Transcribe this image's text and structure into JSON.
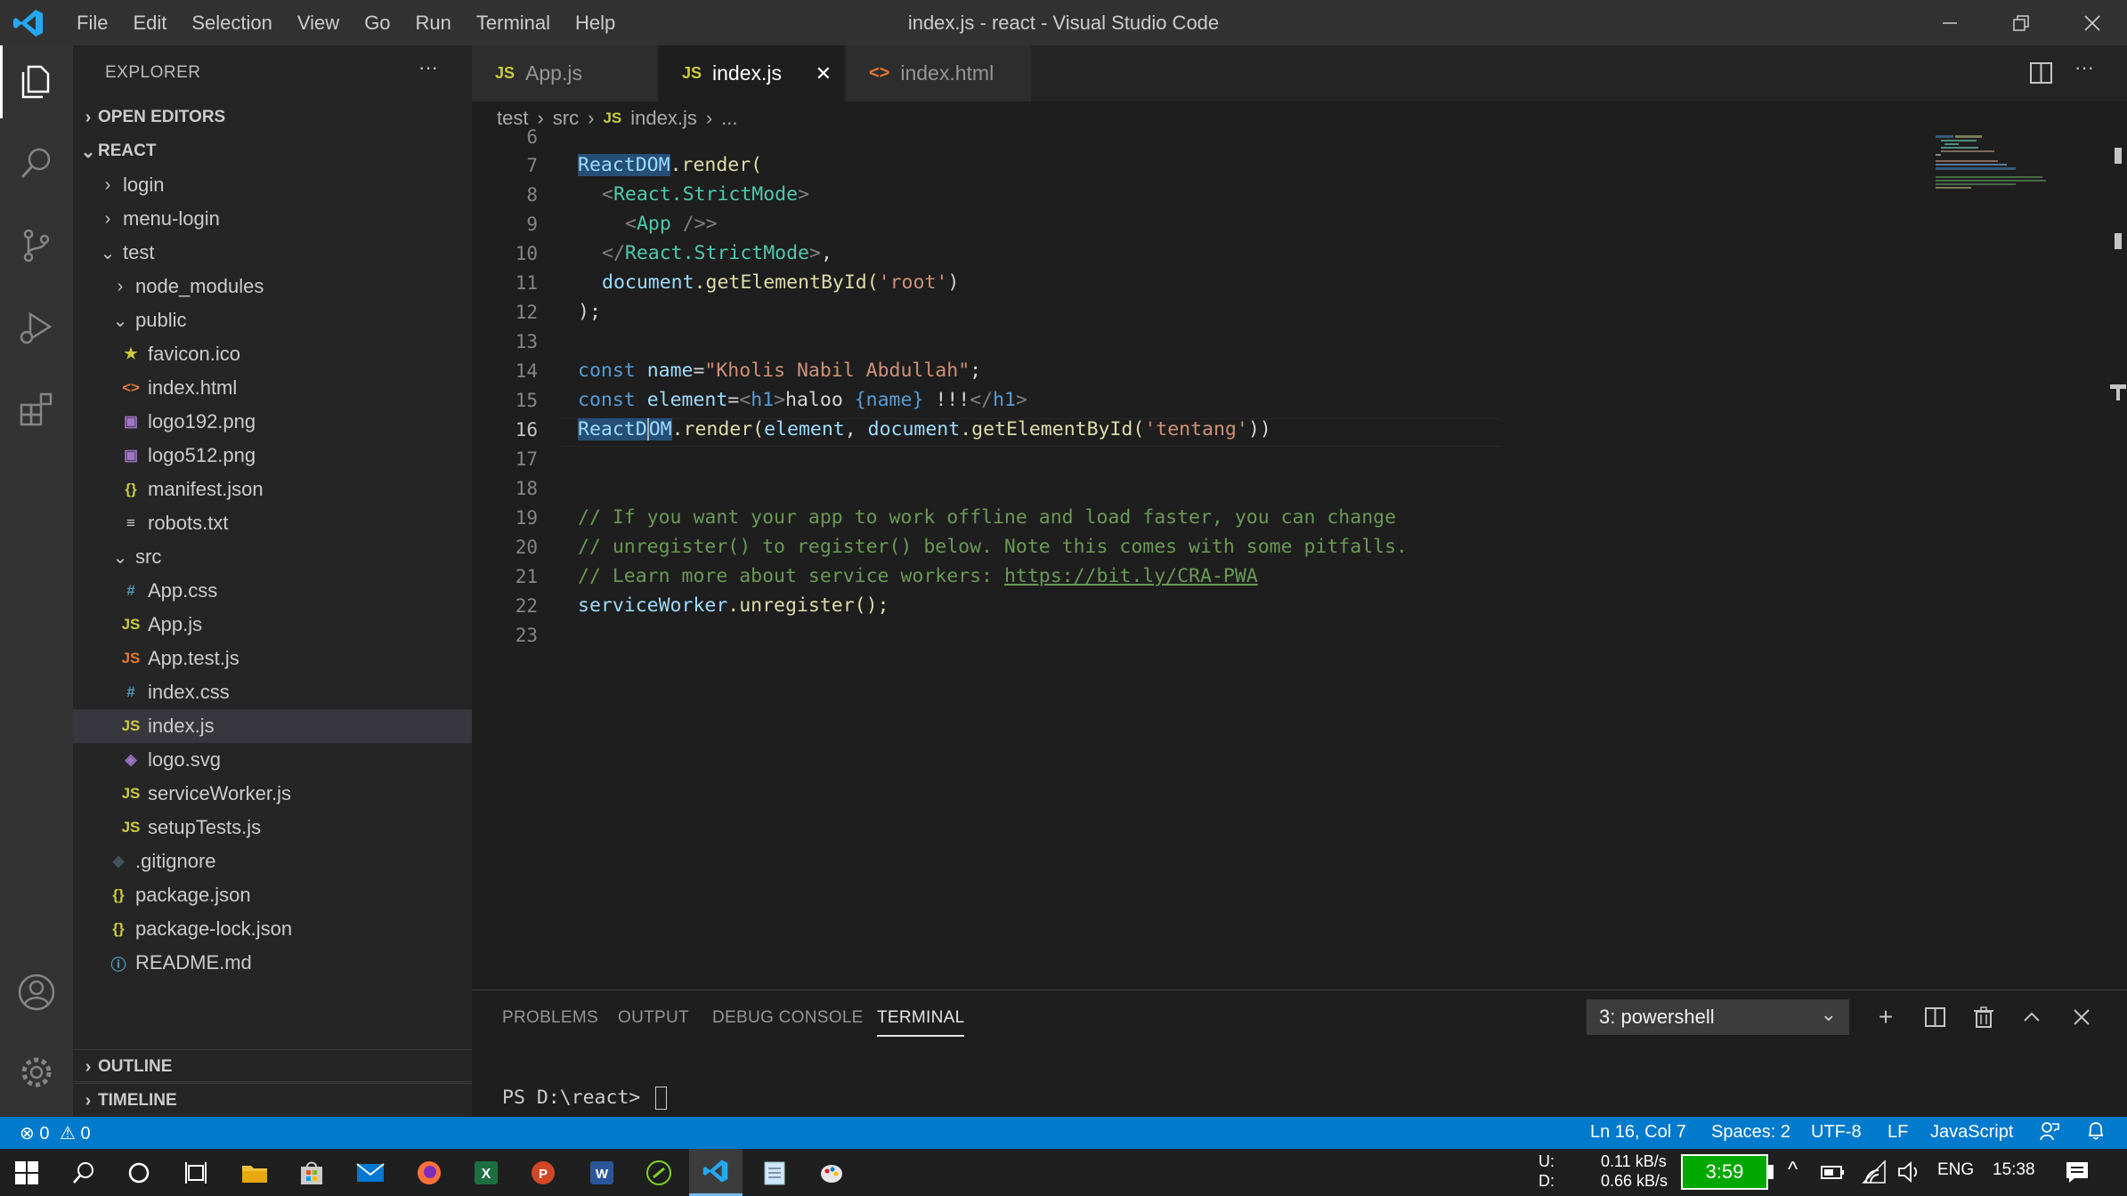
{
  "titlebar": {
    "menus": [
      "File",
      "Edit",
      "Selection",
      "View",
      "Go",
      "Run",
      "Terminal",
      "Help"
    ],
    "title": "index.js - react - Visual Studio Code"
  },
  "activity_bar": {
    "items": [
      "explorer-icon",
      "search-icon",
      "source-control-icon",
      "run-debug-icon",
      "extensions-icon"
    ],
    "bottom": [
      "account-icon",
      "settings-gear-icon"
    ]
  },
  "sidebar": {
    "header": "EXPLORER",
    "more": "···",
    "sections": {
      "open_editors": "OPEN EDITORS",
      "project": "REACT",
      "outline": "OUTLINE",
      "timeline": "TIMELINE"
    },
    "tree": [
      {
        "label": "login",
        "kind": "folder-closed"
      },
      {
        "label": "menu-login",
        "kind": "folder-closed"
      },
      {
        "label": "test",
        "kind": "folder-open"
      },
      {
        "label": "node_modules",
        "kind": "folder-closed"
      },
      {
        "label": "public",
        "kind": "folder-open"
      },
      {
        "label": "favicon.ico",
        "kind": "favicon"
      },
      {
        "label": "index.html",
        "kind": "html"
      },
      {
        "label": "logo192.png",
        "kind": "image"
      },
      {
        "label": "logo512.png",
        "kind": "image"
      },
      {
        "label": "manifest.json",
        "kind": "json"
      },
      {
        "label": "robots.txt",
        "kind": "text"
      },
      {
        "label": "src",
        "kind": "folder-open"
      },
      {
        "label": "App.css",
        "kind": "css"
      },
      {
        "label": "App.js",
        "kind": "js"
      },
      {
        "label": "App.test.js",
        "kind": "js-test"
      },
      {
        "label": "index.css",
        "kind": "css"
      },
      {
        "label": "index.js",
        "kind": "js"
      },
      {
        "label": "logo.svg",
        "kind": "svg"
      },
      {
        "label": "serviceWorker.js",
        "kind": "js"
      },
      {
        "label": "setupTests.js",
        "kind": "js"
      },
      {
        "label": ".gitignore",
        "kind": "git"
      },
      {
        "label": "package.json",
        "kind": "json"
      },
      {
        "label": "package-lock.json",
        "kind": "json"
      },
      {
        "label": "README.md",
        "kind": "info"
      }
    ]
  },
  "tabs": [
    {
      "label": "App.js",
      "badge": "JS"
    },
    {
      "label": "index.js",
      "badge": "JS",
      "close": "✕"
    },
    {
      "label": "index.html",
      "badge": "<>"
    }
  ],
  "breadcrumb": {
    "parts": [
      "test",
      "src",
      "index.js",
      "..."
    ],
    "badge": "JS"
  },
  "editor": {
    "partial_line_number": "6",
    "line_numbers": [
      "7",
      "8",
      "9",
      "10",
      "11",
      "12",
      "13",
      "14",
      "15",
      "16",
      "17",
      "18",
      "19",
      "20",
      "21",
      "22",
      "23"
    ],
    "tokens": {
      "reactdom": "ReactDOM",
      "render_open": ".render(",
      "lt": "<",
      "gt": ">",
      "lt_slash": "</",
      "strict": "React.StrictMode",
      "app": "App",
      "selfclose": " />",
      "comma": ",",
      "document": "document",
      "get_by_id": ".getElementById(",
      "str_root": "'root'",
      "close_paren": ")",
      "close_stmt": ");",
      "const": "const",
      "name": "name",
      "eq": "=",
      "str_name": "\"Kholis Nabil Abdullah\"",
      "semi": ";",
      "element": "element",
      "h1": "h1",
      "haloo": "haloo ",
      "name_expr": "{name}",
      "bangs": " !!!",
      "react": "React",
      "d": "D",
      "om": "OM",
      "comma_sp": ", ",
      "str_tentang": "'tentang'",
      "close2": "))",
      "c19": "// If you want your app to work offline and load faster, you can change",
      "c20": "// unregister() to register() below. Note this comes with some pitfalls.",
      "c21": "// Learn more about service workers: ",
      "c21_link": "https://bit.ly/CRA-PWA",
      "sw": "serviceWorker",
      "unregister": ".unregister();"
    }
  },
  "panel": {
    "tabs": [
      "PROBLEMS",
      "OUTPUT",
      "DEBUG CONSOLE",
      "TERMINAL"
    ],
    "active_tab": "TERMINAL",
    "terminal_select": "3: powershell",
    "prompt": "PS D:\\react> "
  },
  "statusbar": {
    "errors": "0",
    "warnings": "0",
    "position": "Ln 16, Col 7",
    "spaces": "Spaces: 2",
    "encoding": "UTF-8",
    "eol": "LF",
    "language": "JavaScript"
  },
  "taskbar": {
    "net_up_label": "U:",
    "net_down_label": "D:",
    "net_up": "0.11 kB/s",
    "net_down": "0.66 kB/s",
    "battery_time": "3:59",
    "lang": "ENG",
    "clock": "15:38"
  },
  "colors": {
    "accent": "#007acc",
    "editor_bg": "#1e1e1e",
    "sidebar_bg": "#252526",
    "activity_bg": "#333333",
    "titlebar_bg": "#323233"
  }
}
